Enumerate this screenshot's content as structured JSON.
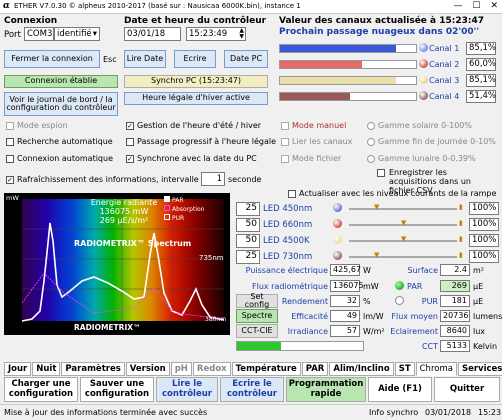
{
  "window": {
    "logo": "α",
    "title": "ETHER V7.0.30 © alpheus 2010-2017 (basé sur : Nausicaa 6000K.bin), instance 1"
  },
  "connexion": {
    "heading": "Connexion",
    "port_label": "Port",
    "port_value": "COM3",
    "port_select": "identifié",
    "close_btn": "Fermer la connexion",
    "esc": "Esc",
    "status": "Connexion établie",
    "journal_btn": "Voir le journal de bord / la configuration du contrôleur",
    "spy_mode": "Mode espion",
    "auto_search": "Recherche automatique",
    "auto_connect": "Connexion automatique"
  },
  "datetime": {
    "heading": "Date et heure du contrôleur",
    "date": "03/01/18",
    "time": "15:23:49",
    "read_btn": "Lire Date",
    "write_btn": "Ecrire",
    "pc_btn": "Date PC",
    "sync_btn": "Synchro PC (15:23:47)",
    "winter_btn": "Heure légale d'hiver active",
    "dst": "Gestion de l'heure d'été / hiver",
    "progressive": "Passage progressif à l'heure légale",
    "sync_pc": "Synchrone avec la date du PC"
  },
  "channels": {
    "heading": "Valeur des canaux actualisée à 15:23:47",
    "next": "Prochain passage nuageux dans 02'00''",
    "list": [
      {
        "label": "Canal 1",
        "pct": "85,1%",
        "fill": 0.851,
        "color": "#3a57d8"
      },
      {
        "label": "Canal 2",
        "pct": "60,0%",
        "fill": 0.6,
        "color": "#e46a6a"
      },
      {
        "label": "Canal 3",
        "pct": "85,1%",
        "fill": 0.851,
        "color": "#e8e0a8"
      },
      {
        "label": "Canal 4",
        "pct": "51,4%",
        "fill": 0.514,
        "color": "#9b5a5a"
      }
    ]
  },
  "modes": {
    "manual": "Mode manuel",
    "link": "Lier les canaux",
    "file": "Mode fichier",
    "solar": "Gamme solaire 0-100%",
    "endday": "Gamme fin de journée 0-10%",
    "lunar": "Gamme lunaire 0-0.39%"
  },
  "refresh": {
    "label": "Rafraîchissement des informations, intervalle de",
    "value": "1",
    "unit": "seconde",
    "save": "Enregistrer les acquisitions dans un fichier CSV"
  },
  "spectrum": {
    "title1": "Energie radiante",
    "title2": "136075 mW",
    "title3": "269 µE/s/m²",
    "brand": "RADIOMETRIX™ Spectrum",
    "nm735": "735nm",
    "nm380": "380nm",
    "footer": "RADIOMETRIX™",
    "mw": "mW",
    "legend_par": "PAR",
    "legend_abs": "Absorption",
    "legend_pur": "PUR"
  },
  "leds": {
    "update_label": "Actualiser avec les niveaux courants de la rampe",
    "list": [
      {
        "value": "25",
        "name": "LED 450nm",
        "dot": "#2a2ad0",
        "pct": "100%",
        "slider": 0.25
      },
      {
        "value": "50",
        "name": "LED 660nm",
        "dot": "#c00000",
        "pct": "100%",
        "slider": 0.5
      },
      {
        "value": "50",
        "name": "LED 4500K",
        "dot": "#e0d060",
        "pct": "100%",
        "slider": 0.5
      },
      {
        "value": "25",
        "name": "LED 730nm",
        "dot": "#602020",
        "pct": "100%",
        "slider": 0.25
      }
    ]
  },
  "measures": {
    "elec_label": "Puissance électrique",
    "elec_val": "425,67",
    "elec_unit": "W",
    "surf_label": "Surface",
    "surf_val": "2.4",
    "surf_unit": "m²",
    "flux_label": "Flux radiométrique",
    "flux_val": "136075",
    "flux_unit": "mW",
    "par_label": "PAR",
    "par_val": "269",
    "par_unit": "µE",
    "config_btn": "Set config",
    "rend_label": "Rendement",
    "rend_val": "32",
    "rend_unit": "%",
    "pur_label": "PUR",
    "pur_val": "181",
    "pur_unit": "µE",
    "spectre_btn": "Spectre",
    "eff_label": "Efficacité",
    "eff_val": "49",
    "eff_unit": "lm/W",
    "fluxm_label": "Flux moyen",
    "fluxm_val": "20736",
    "fluxm_unit": "lumens",
    "cct_btn": "CCT-CIE",
    "irr_label": "Irradiance",
    "irr_val": "57",
    "irr_unit": "W/m²",
    "ecl_label": "Eclairement",
    "ecl_val": "8640",
    "ecl_unit": "lux",
    "cct_label": "CCT",
    "cct_val": "5133",
    "cct_unit": "Kelvin"
  },
  "tabs": [
    "Jour",
    "Nuit",
    "Paramètres",
    "Version",
    "pH",
    "Redox",
    "Température",
    "PAR",
    "Alim/Inclino",
    "ST",
    "Chroma",
    "Services"
  ],
  "bottom": {
    "charge": "Charger une configuration",
    "save": "Sauver une configuration",
    "read": "Lire le contrôleur",
    "write": "Ecrire le contrôleur",
    "prog": "Programmation rapide",
    "help": "Aide (F1)",
    "quit": "Quitter"
  },
  "status": {
    "msg": "Mise à jour des informations terminée avec succès",
    "sync": "Info synchro",
    "date": "03/01/2018",
    "time": "15:23"
  }
}
